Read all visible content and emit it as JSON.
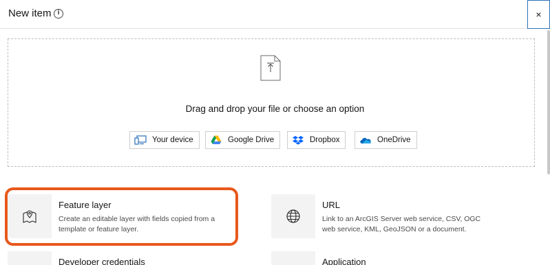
{
  "dialog": {
    "title": "New item",
    "close_label": "×"
  },
  "dropzone": {
    "prompt": "Drag and drop your file or choose an option",
    "options": [
      {
        "label": "Your device",
        "icon": "device-icon"
      },
      {
        "label": "Google Drive",
        "icon": "google-drive-icon"
      },
      {
        "label": "Dropbox",
        "icon": "dropbox-icon"
      },
      {
        "label": "OneDrive",
        "icon": "onedrive-icon"
      }
    ]
  },
  "items": [
    {
      "title": "Feature layer",
      "description": "Create an editable layer with fields copied from a template or feature layer.",
      "icon": "map-pin-icon"
    },
    {
      "title": "URL",
      "description": "Link to an ArcGIS Server web service, CSV, OGC web service, KML, GeoJSON or a document.",
      "icon": "globe-icon"
    },
    {
      "title": "Developer credentials",
      "icon": "key-icon"
    },
    {
      "title": "Application",
      "icon": "app-icon"
    }
  ],
  "colors": {
    "highlight": "#e8581c",
    "accent": "#2a6fb7"
  }
}
